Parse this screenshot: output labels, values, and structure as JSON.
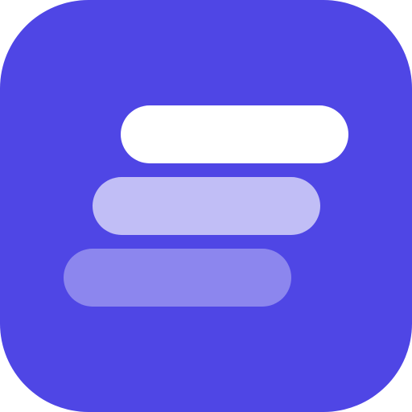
{
  "icon": {
    "name": "stacked-bars-app-icon",
    "background_color": "#4F46E5",
    "bars": [
      {
        "name": "top",
        "color": "#FFFFFF",
        "opacity": 1.0
      },
      {
        "name": "middle",
        "color": "#FFFFFF",
        "opacity": 0.65
      },
      {
        "name": "bottom",
        "color": "#FFFFFF",
        "opacity": 0.35
      }
    ]
  }
}
